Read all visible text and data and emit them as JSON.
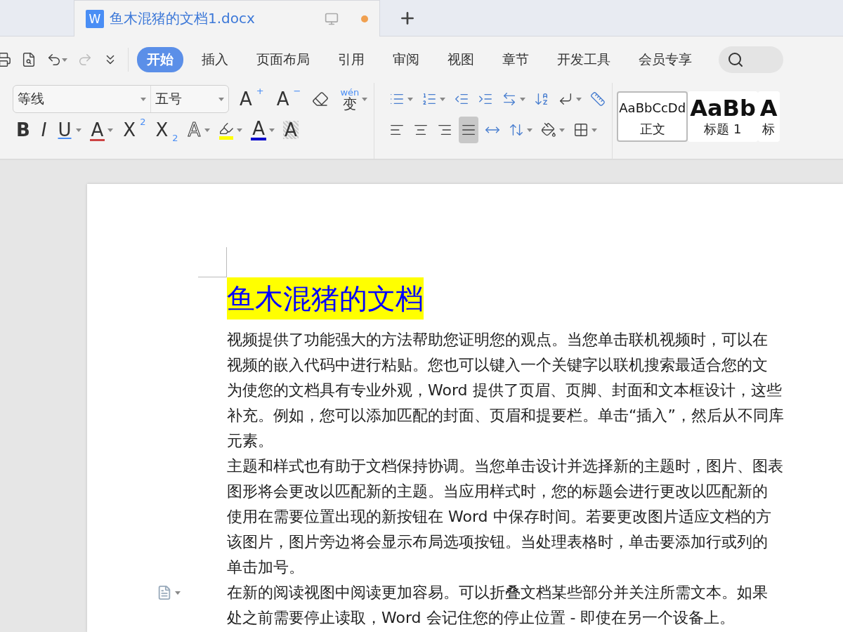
{
  "tabs": [
    {
      "icon_letter": "W",
      "title": "鱼木混猪的文档1.docx",
      "selected": true,
      "unsaved": true
    }
  ],
  "quick_access": [
    {
      "kind": "print",
      "disabled": false
    },
    {
      "kind": "preview",
      "disabled": false
    },
    {
      "kind": "undo",
      "disabled": false
    },
    {
      "kind": "redo",
      "disabled": true
    },
    {
      "kind": "customize",
      "disabled": false
    }
  ],
  "menu": [
    {
      "label": "开始",
      "selected": true
    },
    {
      "label": "插入",
      "selected": false
    },
    {
      "label": "页面布局",
      "selected": false
    },
    {
      "label": "引用",
      "selected": false
    },
    {
      "label": "审阅",
      "selected": false
    },
    {
      "label": "视图",
      "selected": false
    },
    {
      "label": "章节",
      "selected": false
    },
    {
      "label": "开发工具",
      "selected": false
    },
    {
      "label": "会员专享",
      "selected": false
    }
  ],
  "font": {
    "name": "等线",
    "size": "五号"
  },
  "font_tools_top": [
    {
      "kind": "grow",
      "glyph": "A",
      "mark": "+"
    },
    {
      "kind": "shrink",
      "glyph": "A",
      "mark": "−"
    },
    {
      "kind": "eraser"
    },
    {
      "kind": "phonetic",
      "ruby": "wén",
      "glyph": "变"
    }
  ],
  "font_tools_bottom": [
    {
      "kind": "bold",
      "glyph": "B"
    },
    {
      "kind": "italic",
      "glyph": "I"
    },
    {
      "kind": "underline",
      "glyph": "U"
    },
    {
      "kind": "strike",
      "glyph": "A"
    },
    {
      "kind": "sup",
      "glyph": "X",
      "mark": "2"
    },
    {
      "kind": "sub",
      "glyph": "X",
      "mark": "2"
    },
    {
      "kind": "outline",
      "glyph": "A"
    },
    {
      "kind": "highlight",
      "color": "#ffff00"
    },
    {
      "kind": "fontcolor",
      "glyph": "A",
      "color": "#0000cc"
    },
    {
      "kind": "shade",
      "glyph": "A"
    }
  ],
  "paragraph_tools_top": [
    {
      "kind": "bullets"
    },
    {
      "kind": "numbering"
    },
    {
      "kind": "outdent"
    },
    {
      "kind": "indent"
    },
    {
      "kind": "direction"
    },
    {
      "kind": "sort"
    },
    {
      "kind": "break"
    },
    {
      "kind": "ruler"
    }
  ],
  "paragraph_tools_bottom": [
    {
      "kind": "left",
      "selected": false
    },
    {
      "kind": "center",
      "selected": false
    },
    {
      "kind": "right",
      "selected": false
    },
    {
      "kind": "justify",
      "selected": true
    },
    {
      "kind": "distribute",
      "selected": false
    },
    {
      "kind": "spacing",
      "selected": false
    },
    {
      "kind": "fill",
      "selected": false
    },
    {
      "kind": "border",
      "selected": false
    }
  ],
  "styles": [
    {
      "sample": "AaBbCcDd",
      "name": "正文",
      "kind": "normal",
      "selected": true
    },
    {
      "sample": "AaBb",
      "name": "标题 1",
      "kind": "heading",
      "selected": false
    },
    {
      "sample": "A",
      "name": "标",
      "kind": "heading",
      "selected": false
    }
  ],
  "document": {
    "title": "鱼木混猪的文档",
    "lines": [
      {
        "text": "视频提供了功能强大的方法帮助您证明您的观点。当您单击联机视频时，可以在",
        "marker": false
      },
      {
        "text": "视频的嵌入代码中进行粘贴。您也可以键入一个关键字以联机搜索最适合您的文",
        "marker": false
      },
      {
        "text": "为使您的文档具有专业外观，Word 提供了页眉、页脚、封面和文本框设计，这些",
        "marker": false
      },
      {
        "text": "补充。例如，您可以添加匹配的封面、页眉和提要栏。单击“插入”，然后从不同库",
        "marker": false
      },
      {
        "text": "元素。",
        "marker": false
      },
      {
        "text": "主题和样式也有助于文档保持协调。当您单击设计并选择新的主题时，图片、图表",
        "marker": false
      },
      {
        "text": "图形将会更改以匹配新的主题。当应用样式时，您的标题会进行更改以匹配新的",
        "marker": false
      },
      {
        "text": "使用在需要位置出现的新按钮在 Word 中保存时间。若要更改图片适应文档的方",
        "marker": false
      },
      {
        "text": "该图片，图片旁边将会显示布局选项按钮。当处理表格时，单击要添加行或列的",
        "marker": false
      },
      {
        "text": "单击加号。",
        "marker": false
      },
      {
        "text": "在新的阅读视图中阅读更加容易。可以折叠文档某些部分并关注所需文本。如果",
        "marker": true
      },
      {
        "text": "处之前需要停止读取，Word 会记住您的停止位置 - 即使在另一个设备上。",
        "marker": false
      }
    ]
  }
}
